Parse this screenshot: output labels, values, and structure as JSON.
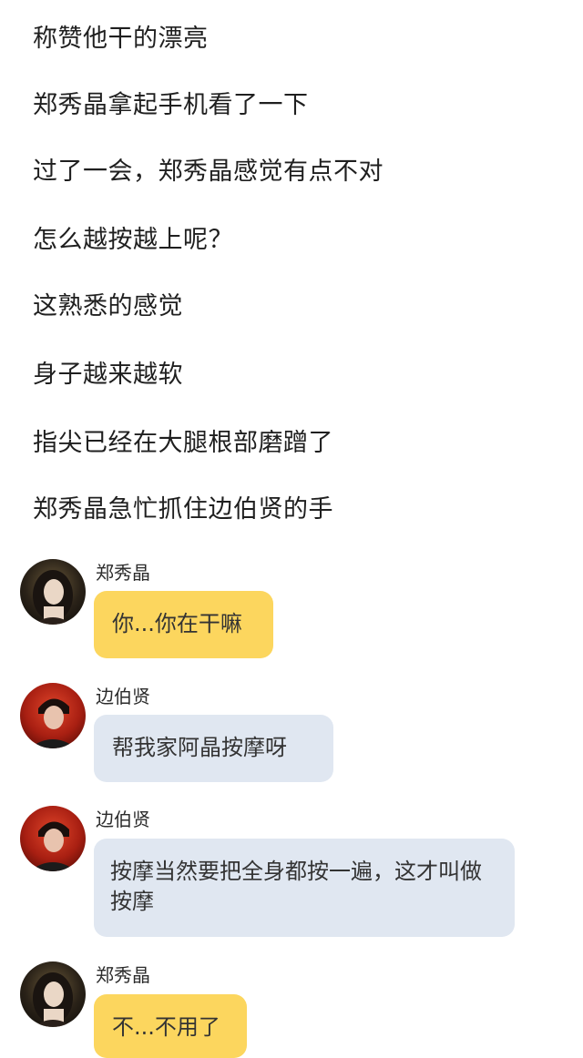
{
  "narration": [
    "称赞他干的漂亮",
    "郑秀晶拿起手机看了一下",
    "过了一会，郑秀晶感觉有点不对",
    "怎么越按越上呢？",
    "这熟悉的感觉",
    "身子越来越软",
    "指尖已经在大腿根部磨蹭了",
    "郑秀晶急忙抓住边伯贤的手"
  ],
  "messages": [
    {
      "sender": "郑秀晶",
      "text": "你...你在干嘛",
      "avatar": "female-avatar",
      "bubble_color": "#fcd65e"
    },
    {
      "sender": "边伯贤",
      "text": "帮我家阿晶按摩呀",
      "avatar": "male-avatar",
      "bubble_color": "#e0e7f1"
    },
    {
      "sender": "边伯贤",
      "text": "按摩当然要把全身都按一遍，这才叫做按摩",
      "avatar": "male-avatar",
      "bubble_color": "#e0e7f1"
    },
    {
      "sender": "郑秀晶",
      "text": "不...不用了",
      "avatar": "female-avatar",
      "bubble_color": "#fcd65e"
    }
  ]
}
